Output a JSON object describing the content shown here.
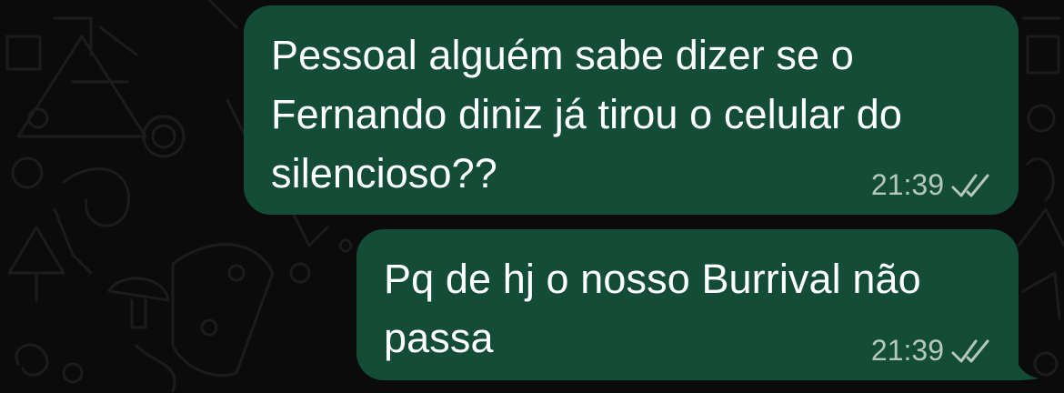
{
  "colors": {
    "background": "#0b0b0b",
    "bubble_outgoing": "#134d37",
    "meta_text": "#b5c7bd",
    "message_text": "#ffffff"
  },
  "messages": [
    {
      "direction": "outgoing",
      "text": "Pessoal alguém sabe dizer se o Fernando diniz já tirou o celular do silencioso??",
      "time": "21:39",
      "status_icon": "double-check-icon"
    },
    {
      "direction": "outgoing",
      "text": "Pq de hj o nosso Burrival não passa",
      "time": "21:39",
      "status_icon": "double-check-icon"
    }
  ]
}
